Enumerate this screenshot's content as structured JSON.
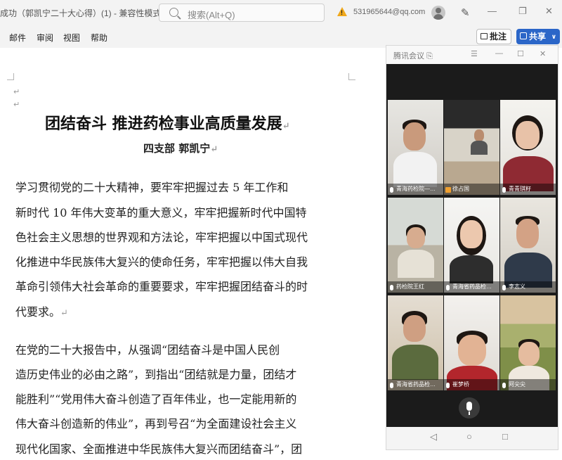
{
  "titlebar": {
    "doc_title": "成功（郭凯宁二十大心得）(1) - 兼容性模式",
    "doc_title_chevron": "∨",
    "search_placeholder": "搜索(Alt+Q)",
    "account": "531965644@qq.com",
    "minimize": "—",
    "restore": "❐",
    "close": "✕"
  },
  "menu": {
    "items": [
      "邮件",
      "审阅",
      "视图",
      "帮助"
    ],
    "comment_label": "批注",
    "share_label": "共享",
    "share_chevron": "∨"
  },
  "doc": {
    "para_mark": "↵",
    "title": "团结奋斗  推进药检事业高质量发展",
    "author": "四支部  郭凯宁",
    "lines": [
      "    学习贯彻党的二十大精神，要牢牢把握过去 5 年工作和",
      "新时代 10 年伟大变革的重大意义，牢牢把握新时代中国特",
      "色社会主义思想的世界观和方法论，牢牢把握以中国式现代",
      "化推进中华民族伟大复兴的使命任务，牢牢把握以伟大自我",
      "革命引领伟大社会革命的重要要求，牢牢把握团结奋斗的时",
      "代要求。",
      "    在党的二十大报告中，从强调“团结奋斗是中国人民创",
      "造历史伟业的必由之路”，到指出“团结就是力量，团结才",
      "能胜利”“党用伟大奋斗创造了百年伟业，也一定能用新的",
      "伟大奋斗创造新的伟业”，再到号召“为全面建设社会主义",
      "现代化国家、全面推进中华民族伟大复兴而团结奋斗”，团"
    ]
  },
  "meeting": {
    "title": "腾讯会议",
    "title_icon": "⎘",
    "menu_icon": "☰",
    "minimize": "—",
    "restore": "☐",
    "close": "✕",
    "participants": [
      "青海药检院—…",
      "徐占国",
      "青青琪籽",
      "药检院王红",
      "青海省药品检…",
      "李志义",
      "青海省药品检…",
      "崔梦桥",
      "阿尖尖"
    ],
    "nav": {
      "back": "◁",
      "home": "○",
      "recent": "□"
    }
  }
}
